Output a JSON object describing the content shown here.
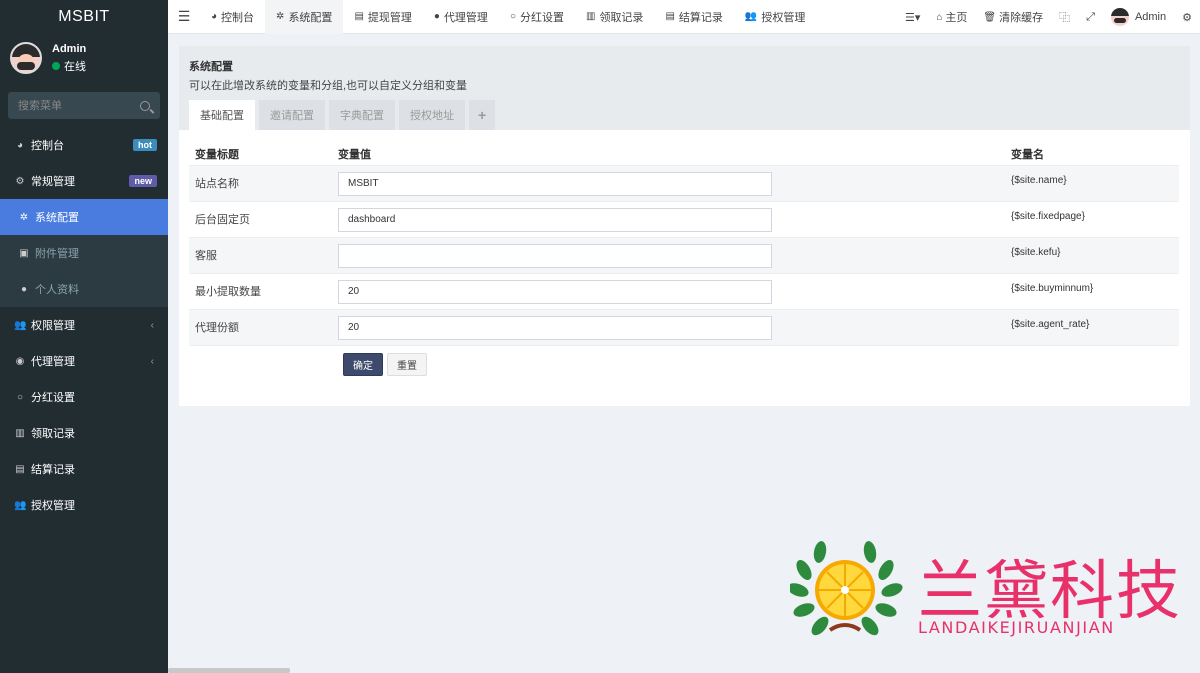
{
  "app": {
    "logo": "MSBIT"
  },
  "user": {
    "name": "Admin",
    "status": "在线"
  },
  "sidebar": {
    "search_placeholder": "搜索菜单",
    "items": [
      {
        "label": "控制台",
        "icon": "dashboard-icon",
        "badge": "hot"
      },
      {
        "label": "常规管理",
        "icon": "cogs-icon",
        "badge": "new"
      },
      {
        "label": "系统配置",
        "icon": "gear-icon"
      },
      {
        "label": "附件管理",
        "icon": "image-icon"
      },
      {
        "label": "个人资料",
        "icon": "user-icon"
      },
      {
        "label": "权限管理",
        "icon": "group-icon"
      },
      {
        "label": "代理管理",
        "icon": "user-circle-icon"
      },
      {
        "label": "分红设置",
        "icon": "circle-icon"
      },
      {
        "label": "领取记录",
        "icon": "bar-chart-icon"
      },
      {
        "label": "结算记录",
        "icon": "card-icon"
      },
      {
        "label": "授权管理",
        "icon": "group-icon"
      }
    ]
  },
  "topbar": {
    "tabs": [
      {
        "label": "控制台",
        "icon": "dashboard-icon"
      },
      {
        "label": "系统配置",
        "icon": "gear-icon"
      },
      {
        "label": "提现管理",
        "icon": "card-icon"
      },
      {
        "label": "代理管理",
        "icon": "user-icon"
      },
      {
        "label": "分红设置",
        "icon": "circle-icon"
      },
      {
        "label": "领取记录",
        "icon": "bar-chart-icon"
      },
      {
        "label": "结算记录",
        "icon": "card-icon"
      },
      {
        "label": "授权管理",
        "icon": "group-icon"
      }
    ],
    "home_label": "主页",
    "clear_cache_label": "清除缓存",
    "user_label": "Admin"
  },
  "panel": {
    "title": "系统配置",
    "description": "可以在此增改系统的变量和分组,也可以自定义分组和变量",
    "tabs": [
      "基础配置",
      "邀请配置",
      "字典配置",
      "授权地址"
    ],
    "table": {
      "headers": [
        "变量标题",
        "变量值",
        "变量名"
      ],
      "rows": [
        {
          "title": "站点名称",
          "value": "MSBIT",
          "name": "{$site.name}"
        },
        {
          "title": "后台固定页",
          "value": "dashboard",
          "name": "{$site.fixedpage}"
        },
        {
          "title": "客服",
          "value": "",
          "name": "{$site.kefu}"
        },
        {
          "title": "最小提取数量",
          "value": "20",
          "name": "{$site.buyminnum}"
        },
        {
          "title": "代理份额",
          "value": "20",
          "name": "{$site.agent_rate}"
        }
      ]
    },
    "submit_label": "确定",
    "reset_label": "重置"
  },
  "watermark": {
    "title": "兰黛科技",
    "subtitle": "LANDAIKEJIRUANJIAN"
  },
  "colors": {
    "sidebar_bg": "#222d32",
    "active_menu": "#4a7bdf",
    "primary_button": "#3d4a6b",
    "watermark": "#e8306a"
  }
}
